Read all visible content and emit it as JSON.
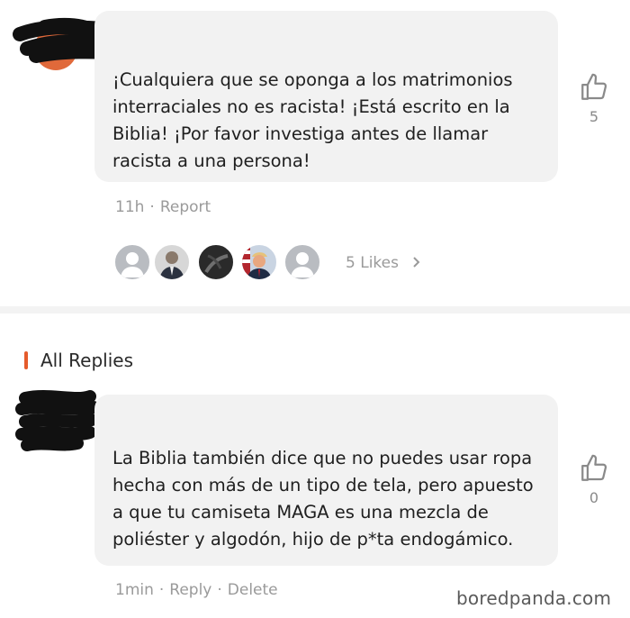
{
  "comment": {
    "text": "¡Cualquiera que se oponga a los matrimonios interraciales no es racista! ¡Está escrito en la Biblia! ¡Por favor investiga antes de llamar racista a una persona!",
    "like_count": "5",
    "time": "11h",
    "report_label": "Report",
    "likes_label": "5 Likes"
  },
  "replies_section": {
    "heading": "All Replies"
  },
  "reply": {
    "text": "La Biblia también dice que no puedes usar ropa hecha con más de un tipo de tela, pero apuesto a que tu camiseta MAGA es una mezcla de poliéster y algodón, hijo de p*ta endogámico.",
    "like_count": "0",
    "time": "1min",
    "reply_label": "Reply",
    "delete_label": "Delete"
  },
  "watermark": "boredpanda.com",
  "colors": {
    "bubble": "#f2f2f2",
    "accent": "#e55b2c",
    "muted_text": "#9a9a9a"
  }
}
